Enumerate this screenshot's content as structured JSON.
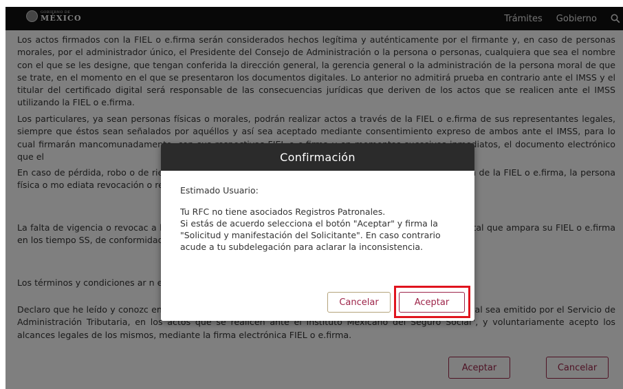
{
  "header": {
    "logo_small": "GOBIERNO DE",
    "logo_big": "MÉXICO",
    "nav": [
      "Trámites",
      "Gobierno"
    ],
    "search_icon": "search-icon"
  },
  "page": {
    "paragraphs": [
      "Los actos firmados con la FIEL o e.firma serán considerados hechos legítima y auténticamente por el firmante y, en caso de personas morales, por el administrador único, el Presidente del Consejo de Administración o la persona o personas, cualquiera que sea el nombre con el que se les designe, que tengan conferida la dirección general, la gerencia general o la administración de la persona moral de que se trate, en el momento en el que se presentaron los documentos digitales. Lo anterior no admitirá prueba en contrario ante el IMSS y el titular del certificado digital será responsable de las consecuencias jurídicas que deriven de los actos que se realicen ante el IMSS utilizando la FIEL o e.firma.",
      "Los particulares, ya sean personas físicas o morales, podrán realizar actos a través de la FIEL o e.firma de sus representantes legales, siempre que éstos sean señalados por aquéllos y así sea aceptado mediante consentimiento expreso de ambos ante el IMSS, para lo cual firmarán mancomunadamente, con sus respectivas FIEL o e.firma y en momentos sucesivos inmediatos, el documento electrónico que el",
      "En caso de pérdida, robo o de                                                                   riesgo la confidencialidad de los certificados electrónicos,                                                                  n no autorizada de la FIEL o e.firma, la persona física o mo                                                                  ediata revocación o reposición ante el SAT, sujetándose a los p",
      "La falta de vigencia o revocac                                                                  a la persona física o moral de cumplir con sus obligaciones                                                                  ertificado digital que ampara su FIEL o e.firma en los tiempo                                                                  SS, de conformidad con la Ley del Seguro Social, sus Reglam",
      "Los términos y condiciones ar                                                                  n este acto realice el firmante, mediante su firma electrónica",
      "Declaro que he leído y conozc                                                                  eneral para el uso de la Firma Electrónica Avanzada, cuyo certificado digital sea emitido por el Servicio de Administración Tributaria, en los actos que se realicen ante el Instituto Mexicano del Seguro Social\", y voluntariamente acepto los alcances legales de los mismos, mediante la firma electrónica FIEL o e.firma."
    ],
    "accept_label": "Aceptar",
    "cancel_label": "Cancelar"
  },
  "modal": {
    "title": "Confirmación",
    "greeting": "Estimado Usuario:",
    "message": "Tu RFC no tiene asociados Registros Patronales.\nSi estás de acuerdo selecciona el botón \"Aceptar\" y firma la \"Solicitud y manifestación del Solicitante\". En caso contrario acude a tu subdelegación para aclarar la inconsistencia.",
    "cancel_label": "Cancelar",
    "accept_label": "Aceptar"
  },
  "colors": {
    "brand": "#9d2449",
    "highlight": "#e0131d",
    "header_bg": "#111111",
    "modal_header_bg": "#2b2b2b"
  }
}
